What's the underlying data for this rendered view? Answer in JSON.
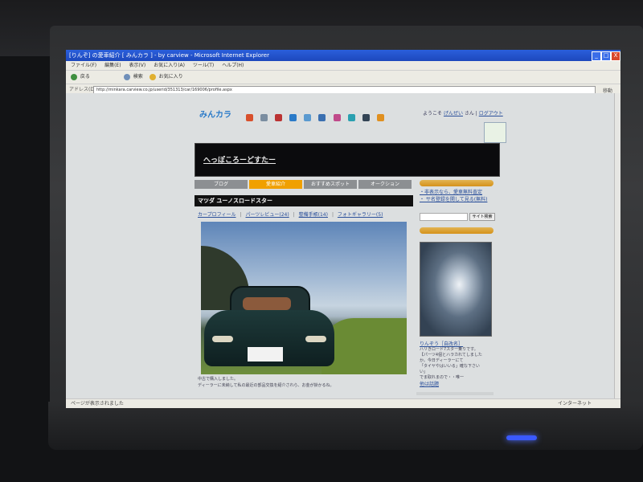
{
  "window": {
    "title": "[りんぞ] の愛車紹介 [ みんカラ ] - by carview - Microsoft Internet Explorer",
    "controls": [
      "_",
      "□",
      "X"
    ]
  },
  "menu": [
    "ファイル(F)",
    "編集(E)",
    "表示(V)",
    "お気に入り(A)",
    "ツール(T)",
    "ヘルプ(H)"
  ],
  "toolbar": {
    "back": "戻る",
    "search": "検索",
    "favorites": "お気に入り"
  },
  "address": {
    "label": "アドレス(D)",
    "url": "http://minkara.carview.co.jp/userid/351313/car/169006/profile.aspx",
    "go": "移動"
  },
  "status": {
    "left": "ページが表示されました",
    "right": "インターネット"
  },
  "site": {
    "logo": "みんカラ",
    "welcome_prefix": "ようこそ",
    "welcome_user": "げんぜい",
    "welcome_suffix": "さん",
    "logout": "ログアウト"
  },
  "banner": {
    "title": "へっぽころーどすたー"
  },
  "tabs": [
    "ブログ",
    "愛車紹介",
    "おすすめスポット",
    "オークション"
  ],
  "main": {
    "heading": "マツダ ユーノスロードスター",
    "subtabs": [
      "カープロフィール",
      "パーツレビュー(24)",
      "整備手帳(14)",
      "フォトギャラリー(5)"
    ],
    "caption_1": "中古で購入しました。",
    "caption_2": "ディーラーに未納して私の最近の部品交換を紹介されら、お金が掛かるね。"
  },
  "sidebar": {
    "links": [
      "・非表示なら、愛車無料査定",
      "・ サ名登録を開して見る(無料)"
    ],
    "search_button": "サイト検索",
    "profile_name": "りんぞう［自改名］",
    "profile_text": [
      "ハリきロード7スター乗りです。",
      "【パーツ4個とハラカれてしました",
      "か。今日ディーラーにて",
      "「タイヤやはいいる」確な下さい",
      "い」",
      "でま取れまので・・唯一"
    ],
    "profile_more": "他は話題"
  },
  "colors": {
    "accent": "#f0a000",
    "ie_blue": "#1d48bd",
    "banner": "#0b0b0d"
  }
}
